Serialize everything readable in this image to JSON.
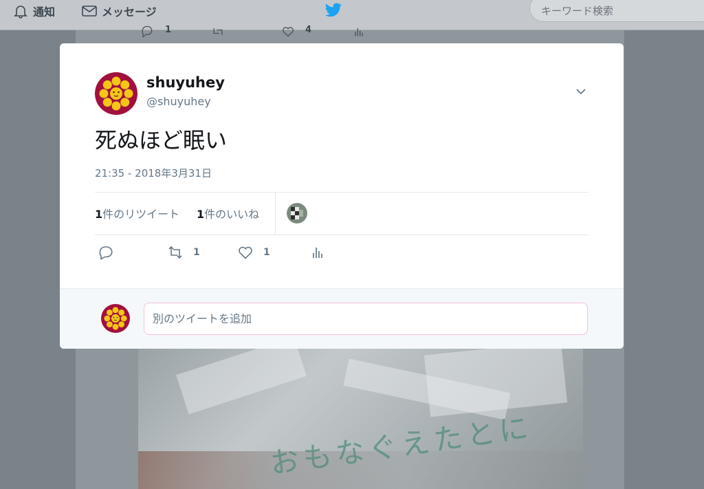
{
  "topnav": {
    "notifications_label": "通知",
    "messages_label": "メッセージ",
    "search_placeholder": "キーワード検索"
  },
  "background": {
    "bag_text": "おもなぐえたとに",
    "behind_reply_count": "1",
    "behind_like_count": "4"
  },
  "tweet": {
    "display_name": "shuyuhey",
    "handle": "@shuyuhey",
    "text": "死ぬほど眠い",
    "timestamp": "21:35 - 2018年3月31日",
    "retweet_count": "1",
    "retweet_label": "件のリツイート",
    "like_count": "1",
    "like_label": "件のいいね",
    "actions": {
      "retweet_count": "1",
      "like_count": "1"
    }
  },
  "reply": {
    "placeholder": "別のツイートを追加"
  },
  "colors": {
    "brand_blue": "#1da1f2",
    "avatar_maroon": "#a2103e",
    "avatar_yellow": "#f5c518",
    "muted_text": "#657786"
  }
}
